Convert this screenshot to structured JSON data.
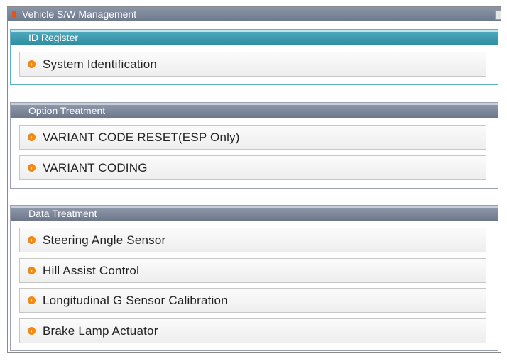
{
  "window": {
    "title": "Vehicle S/W Management"
  },
  "groups": [
    {
      "header": "ID Register",
      "items": [
        {
          "label": "System Identification"
        }
      ]
    },
    {
      "header": "Option Treatment",
      "items": [
        {
          "label": "VARIANT CODE RESET(ESP Only)"
        },
        {
          "label": "VARIANT CODING"
        }
      ]
    },
    {
      "header": "Data Treatment",
      "items": [
        {
          "label": "Steering Angle Sensor"
        },
        {
          "label": "Hill Assist Control"
        },
        {
          "label": "Longitudinal G Sensor Calibration"
        },
        {
          "label": "Brake Lamp Actuator"
        }
      ]
    }
  ],
  "colors": {
    "id_header": "#3a9bb0",
    "gray_header": "#7c869a",
    "bullet": "#f08a14"
  },
  "icons": {
    "title": "vehicle-flag-icon",
    "bullet": "arrow-circle-icon"
  }
}
